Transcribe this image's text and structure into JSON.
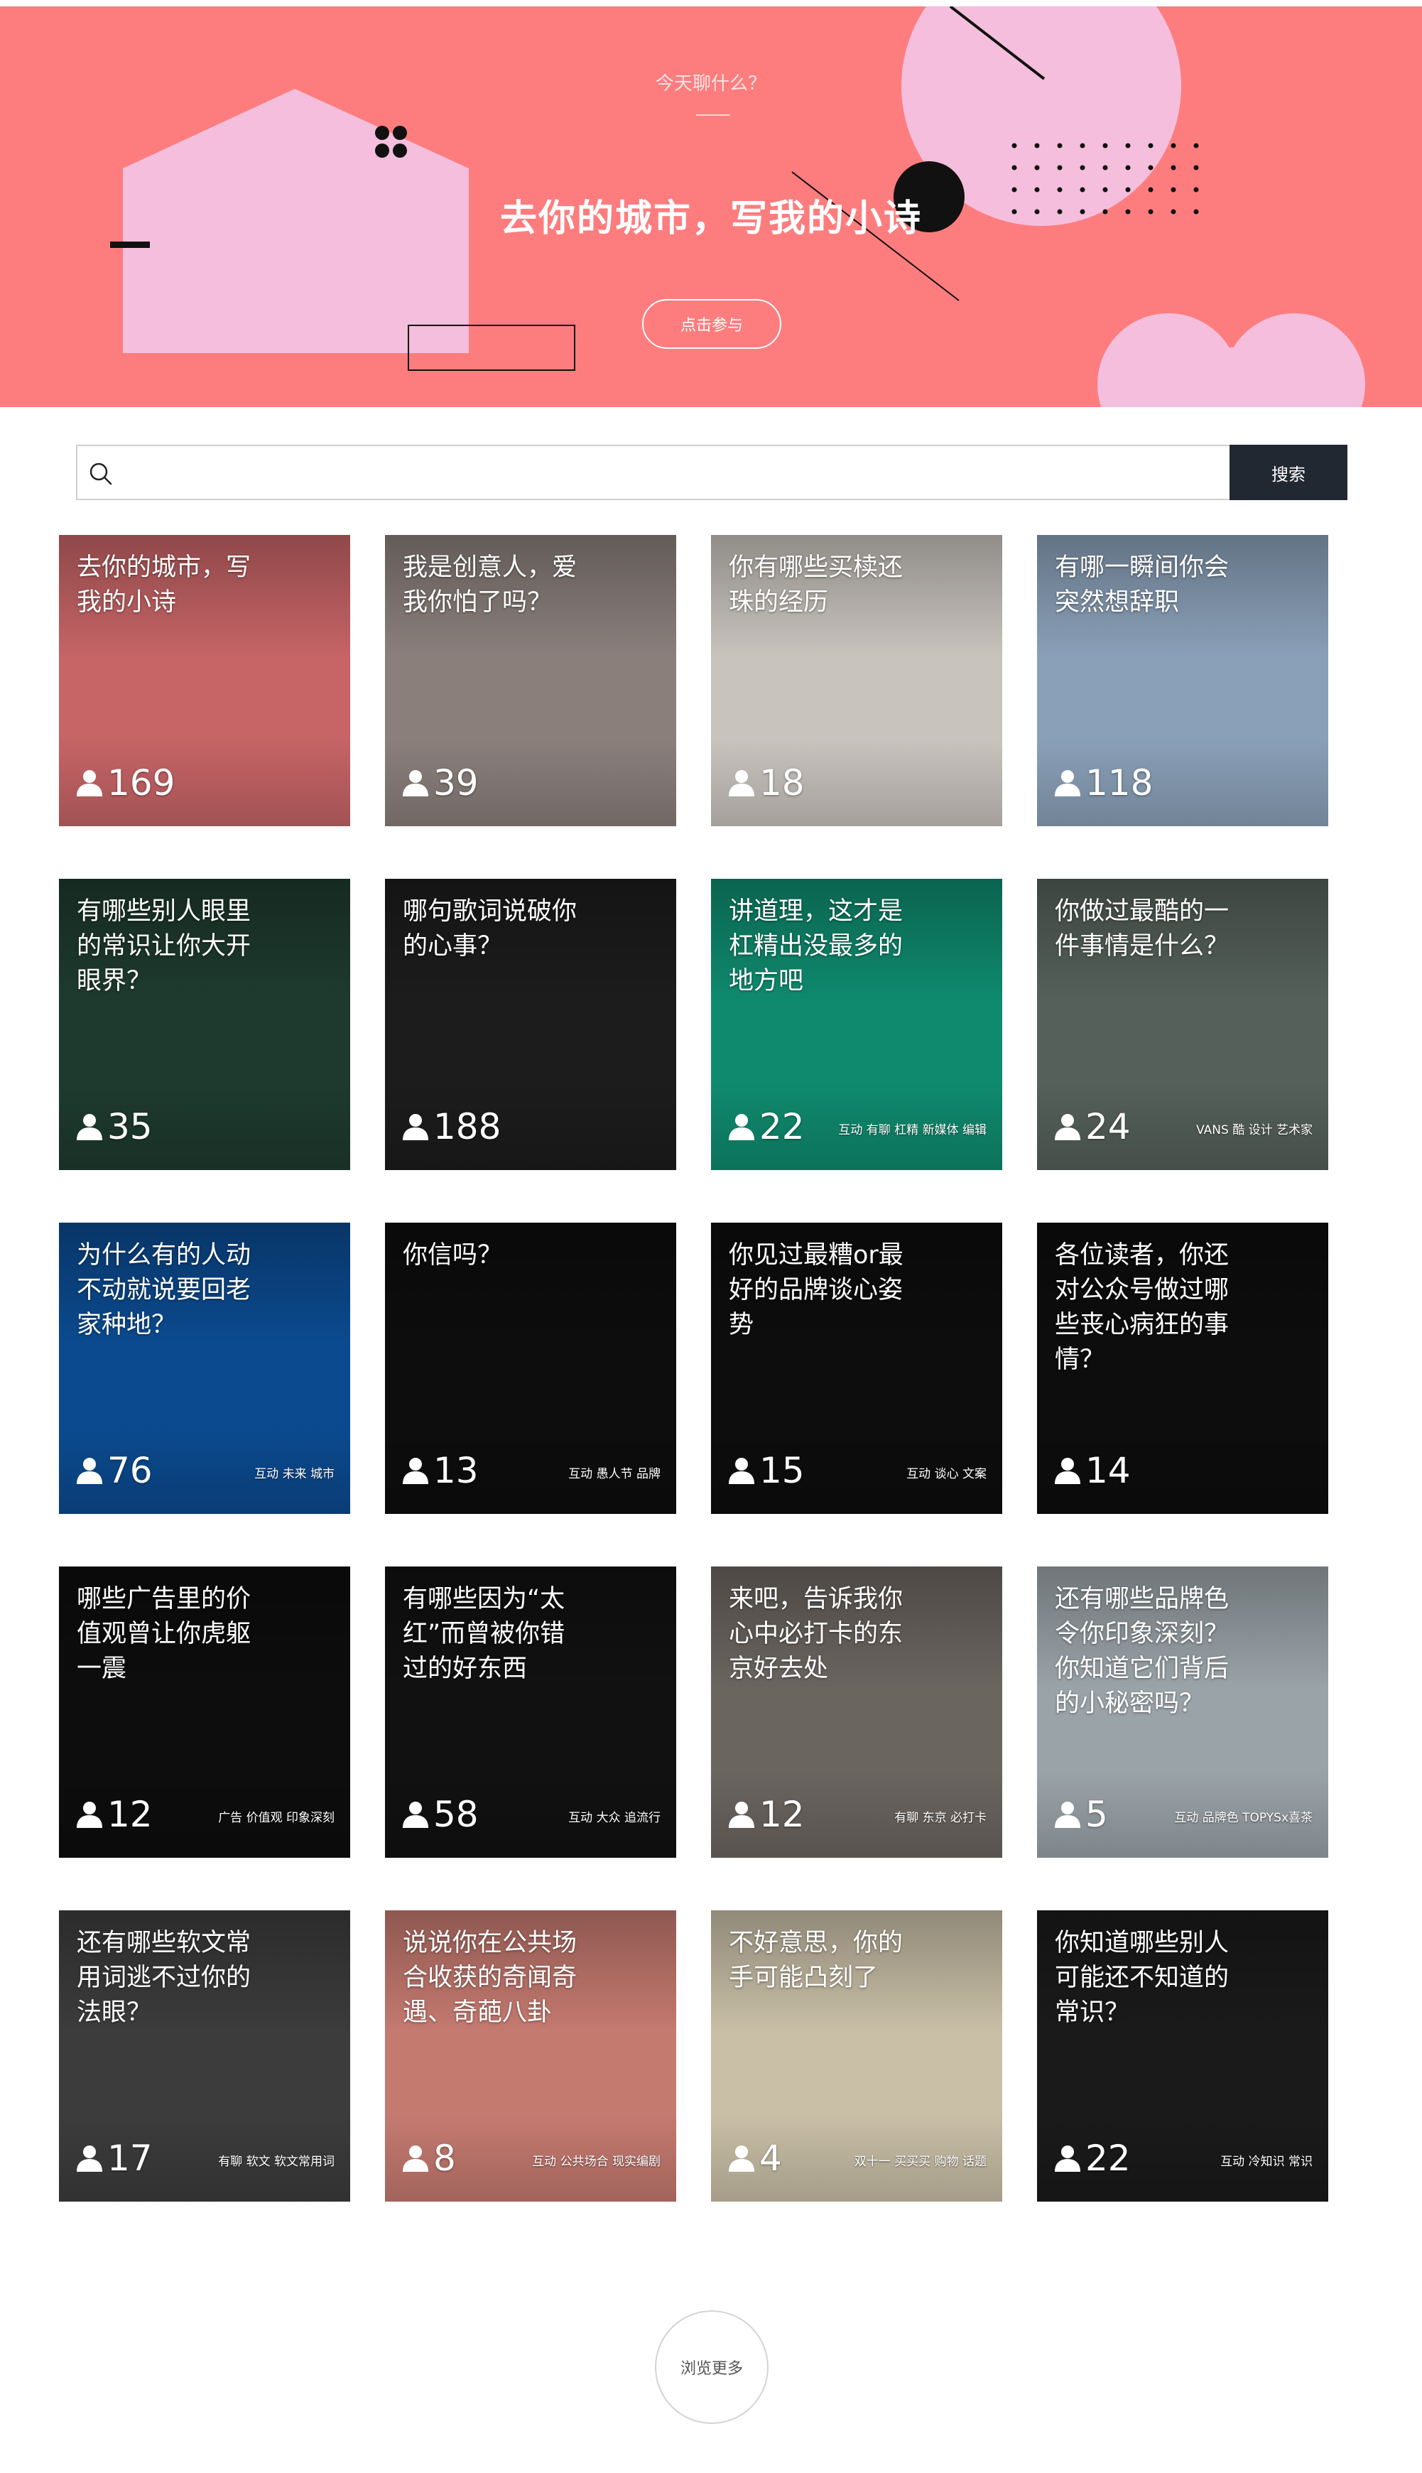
{
  "hero": {
    "kicker": "今天聊什么？",
    "title": "去你的城市，写我的小诗",
    "cta": "点击参与",
    "colors": {
      "background": "#fd7d7e",
      "accent_pink": "#f5bedd",
      "ink": "#111111"
    }
  },
  "search": {
    "placeholder": "",
    "button": "搜索",
    "icon": "search-icon"
  },
  "topics": [
    {
      "title": "去你的城市，写我的小诗",
      "count": "169",
      "tags": "",
      "bg": "#c66466"
    },
    {
      "title": "我是创意人，爱我你怕了吗？",
      "count": "39",
      "tags": "",
      "bg": "#8a7f7b"
    },
    {
      "title": "你有哪些买椟还珠的经历",
      "count": "18",
      "tags": "",
      "bg": "#c8c3bd"
    },
    {
      "title": "有哪一瞬间你会突然想辞职",
      "count": "118",
      "tags": "",
      "bg": "#8aa0b8"
    },
    {
      "title": "有哪些别人眼里的常识让你大开眼界？",
      "count": "35",
      "tags": "",
      "bg": "#1e3a2e"
    },
    {
      "title": "哪句歌词说破你的心事？",
      "count": "188",
      "tags": "",
      "bg": "#1c1c1c"
    },
    {
      "title": "讲道理，这才是杠精出没最多的地方吧",
      "count": "22",
      "tags": "互动 有聊 杠精 新媒体 编辑",
      "bg": "#0f8a6e"
    },
    {
      "title": "你做过最酷的一件事情是什么？",
      "count": "24",
      "tags": "VANS 酷 设计 艺术家",
      "bg": "#55605a"
    },
    {
      "title": "为什么有的人动不动就说要回老家种地？",
      "count": "76",
      "tags": "互动 未来 城市",
      "bg": "#0b4a8f"
    },
    {
      "title": "你信吗？",
      "count": "13",
      "tags": "互动 愚人节 品牌",
      "bg": "#0d0d0d"
    },
    {
      "title": "你见过最糟or最好的品牌谈心姿势",
      "count": "15",
      "tags": "互动 谈心 文案",
      "bg": "#0d0d0d"
    },
    {
      "title": "各位读者，你还对公众号做过哪些丧心病狂的事情？",
      "count": "14",
      "tags": "",
      "bg": "#0d0d0d"
    },
    {
      "title": "哪些广告里的价值观曾让你虎躯一震",
      "count": "12",
      "tags": "广告 价值观 印象深刻",
      "bg": "#0d0d0d"
    },
    {
      "title": "有哪些因为“太红”而曾被你错过的好东西",
      "count": "58",
      "tags": "互动 大众 追流行",
      "bg": "#111111"
    },
    {
      "title": "来吧，告诉我你心中必打卡的东京好去处",
      "count": "12",
      "tags": "有聊 东京 必打卡",
      "bg": "#6b6560"
    },
    {
      "title": "还有哪些品牌色令你印象深刻？你知道它们背后的小秘密吗？",
      "count": "5",
      "tags": "互动 品牌色 TOPYSx喜茶",
      "bg": "#9aa3a8"
    },
    {
      "title": "还有哪些软文常用词逃不过你的法眼？",
      "count": "17",
      "tags": "有聊 软文 软文常用词",
      "bg": "#3c3c3c"
    },
    {
      "title": "说说你在公共场合收获的奇闻奇遇、奇葩八卦",
      "count": "8",
      "tags": "互动 公共场合 现实编剧",
      "bg": "#c57a70"
    },
    {
      "title": "不好意思，你的手可能凸刻了",
      "count": "4",
      "tags": "双十一 买买买 购物 话题",
      "bg": "#c9bfa7"
    },
    {
      "title": "你知道哪些别人可能还不知道的常识？",
      "count": "22",
      "tags": "互动 冷知识 常识",
      "bg": "#1a1a1a"
    }
  ],
  "more": {
    "label": "浏览更多"
  }
}
